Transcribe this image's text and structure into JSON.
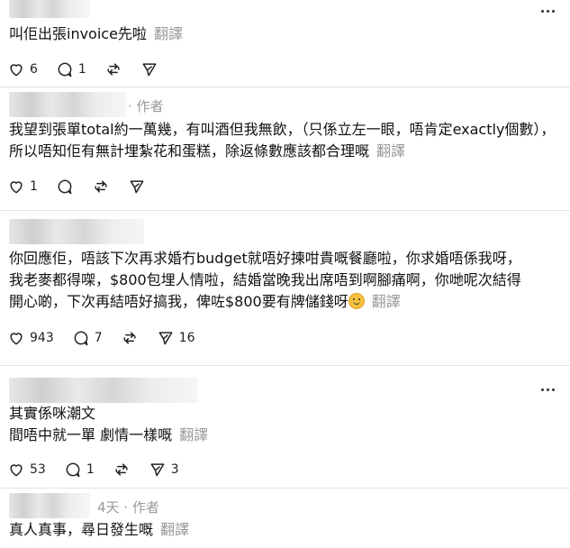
{
  "ui": {
    "translate_label": "翻譯",
    "author_tag": "· 作者",
    "time_author": "4天 · 作者"
  },
  "comments": [
    {
      "text": "叫佢出張invoice先啦",
      "likes": "6",
      "replies": "1",
      "reposts": "",
      "shares": ""
    },
    {
      "text": "我望到張單total約一萬幾，有叫酒但我無飲，（只係立左一眼，唔肯定exactly個數），所以唔知佢有無計埋紮花和蛋糕，除返條數應該都合理嘅",
      "likes": "1",
      "replies": "",
      "reposts": "",
      "shares": ""
    },
    {
      "text_line1": "你回應佢，唔該下次再求婚冇budget就唔好揀咁貴嘅餐廳啦，你求婚唔係我呀，",
      "text_line2": "我老麥都得㗎，$800包埋人情啦，結婚當晚我出席唔到啊腳痛啊，你哋呢次結得",
      "text_line3": "開心啲，下次再結唔好搞我，俾咗$800要有牌儲錢呀",
      "likes": "943",
      "replies": "7",
      "reposts": "",
      "shares": "16"
    },
    {
      "text_line1": "其實係咪潮文",
      "text_line2": "間唔中就一單 劇情一樣嘅",
      "likes": "53",
      "replies": "1",
      "reposts": "",
      "shares": "3"
    },
    {
      "text": "真人真事，尋日發生嘅"
    }
  ]
}
